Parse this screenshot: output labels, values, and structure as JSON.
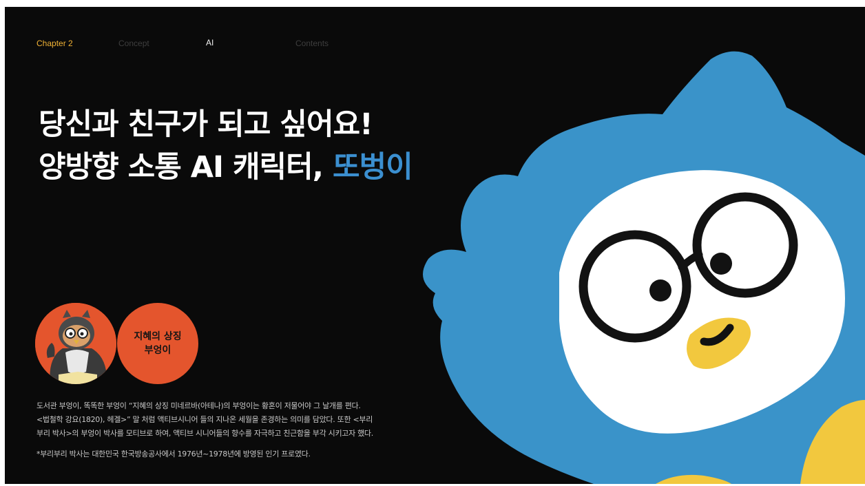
{
  "nav": {
    "items": [
      "Chapter 2",
      "Concept",
      "AI",
      "Contents"
    ]
  },
  "headline": {
    "line1": "당신과 친구가 되고 싶어요!",
    "line2_prefix": "양방향 소통 AI 캐릭터, ",
    "line2_accent": "또벙이"
  },
  "badge": {
    "line1": "지혜의 상징",
    "line2": "부엉이"
  },
  "description": {
    "lines": [
      "도서관 부엉이, 똑똑한 부엉이 “지혜의 상징 미네르바(아테나)의 부엉이는 황혼이 저물어야 그 날개를 편다.",
      "<법철학 강요(1820), 헤겔>” 말 처럼 액티브시니어 들의 지나온 세월을 존경하는 의미를 담았다. 또한 <부리",
      "부리 박사>의 부엉이 박사를 모티브로 하여, 액티브 시니어들의 향수를 자극하고 친근함을 부각 시키고자 했다."
    ],
    "note": "*부리부리 박사는 대한민국 한국방송공사에서 1976년~1978년에 방영된 인기 프로였다."
  },
  "colors": {
    "background": "#0a0a0a",
    "accent_blue": "#3b8fd0",
    "nav_active": "#f2b335",
    "badge_orange": "#e4552d",
    "mascot_blue": "#3a93c9",
    "mascot_yellow": "#f2c83e"
  },
  "icons": {
    "mascot": "owl-mascot-illustration",
    "photo": "owl-costume-photo"
  }
}
